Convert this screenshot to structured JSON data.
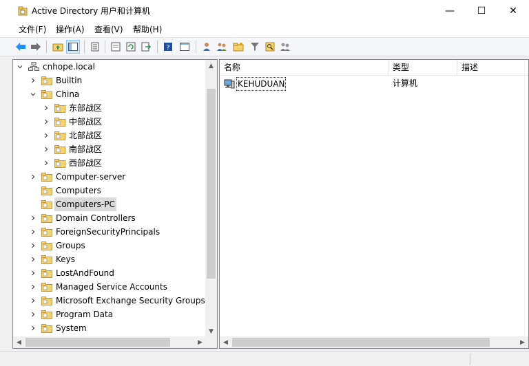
{
  "window": {
    "title": "Active Directory 用户和计算机",
    "minimize_symbol": "—",
    "maximize_symbol": "☐",
    "close_symbol": "✕"
  },
  "menu": [
    "文件(F)",
    "操作(A)",
    "查看(V)",
    "帮助(H)"
  ],
  "toolbar": {
    "icons": [
      "back-arrow-icon",
      "forward-arrow-icon",
      "up-folder-icon",
      "show-hide-console-tree-icon",
      "properties-icon",
      "export-list-icon",
      "refresh-icon",
      "export-icon",
      "help-icon",
      "action-pane-icon",
      "new-user-icon",
      "new-group-icon",
      "new-ou-icon",
      "filter-icon",
      "find-icon",
      "add-to-group-icon"
    ],
    "accent": "#1e90ff"
  },
  "tree": {
    "root": "cnhope.local",
    "items": [
      {
        "label": "Builtin",
        "level": 1,
        "expander": "collapsed"
      },
      {
        "label": "China",
        "level": 1,
        "expander": "expanded"
      },
      {
        "label": "东部战区",
        "level": 2,
        "expander": "collapsed"
      },
      {
        "label": "中部战区",
        "level": 2,
        "expander": "collapsed"
      },
      {
        "label": "北部战区",
        "level": 2,
        "expander": "collapsed"
      },
      {
        "label": "南部战区",
        "level": 2,
        "expander": "collapsed"
      },
      {
        "label": "西部战区",
        "level": 2,
        "expander": "collapsed"
      },
      {
        "label": "Computer-server",
        "level": 1,
        "expander": "collapsed"
      },
      {
        "label": "Computers",
        "level": 1,
        "expander": "none"
      },
      {
        "label": "Computers-PC",
        "level": 1,
        "expander": "none",
        "selected": true
      },
      {
        "label": "Domain Controllers",
        "level": 1,
        "expander": "collapsed"
      },
      {
        "label": "ForeignSecurityPrincipals",
        "level": 1,
        "expander": "collapsed"
      },
      {
        "label": "Groups",
        "level": 1,
        "expander": "collapsed"
      },
      {
        "label": "Keys",
        "level": 1,
        "expander": "collapsed"
      },
      {
        "label": "LostAndFound",
        "level": 1,
        "expander": "collapsed"
      },
      {
        "label": "Managed Service Accounts",
        "level": 1,
        "expander": "collapsed"
      },
      {
        "label": "Microsoft Exchange Security Groups",
        "level": 1,
        "expander": "collapsed"
      },
      {
        "label": "Program Data",
        "level": 1,
        "expander": "collapsed"
      },
      {
        "label": "System",
        "level": 1,
        "expander": "collapsed"
      }
    ]
  },
  "list": {
    "columns": [
      "名称",
      "类型",
      "描述"
    ],
    "rows": [
      {
        "name": "KEHUDUAN",
        "type": "计算机",
        "description": ""
      }
    ]
  }
}
